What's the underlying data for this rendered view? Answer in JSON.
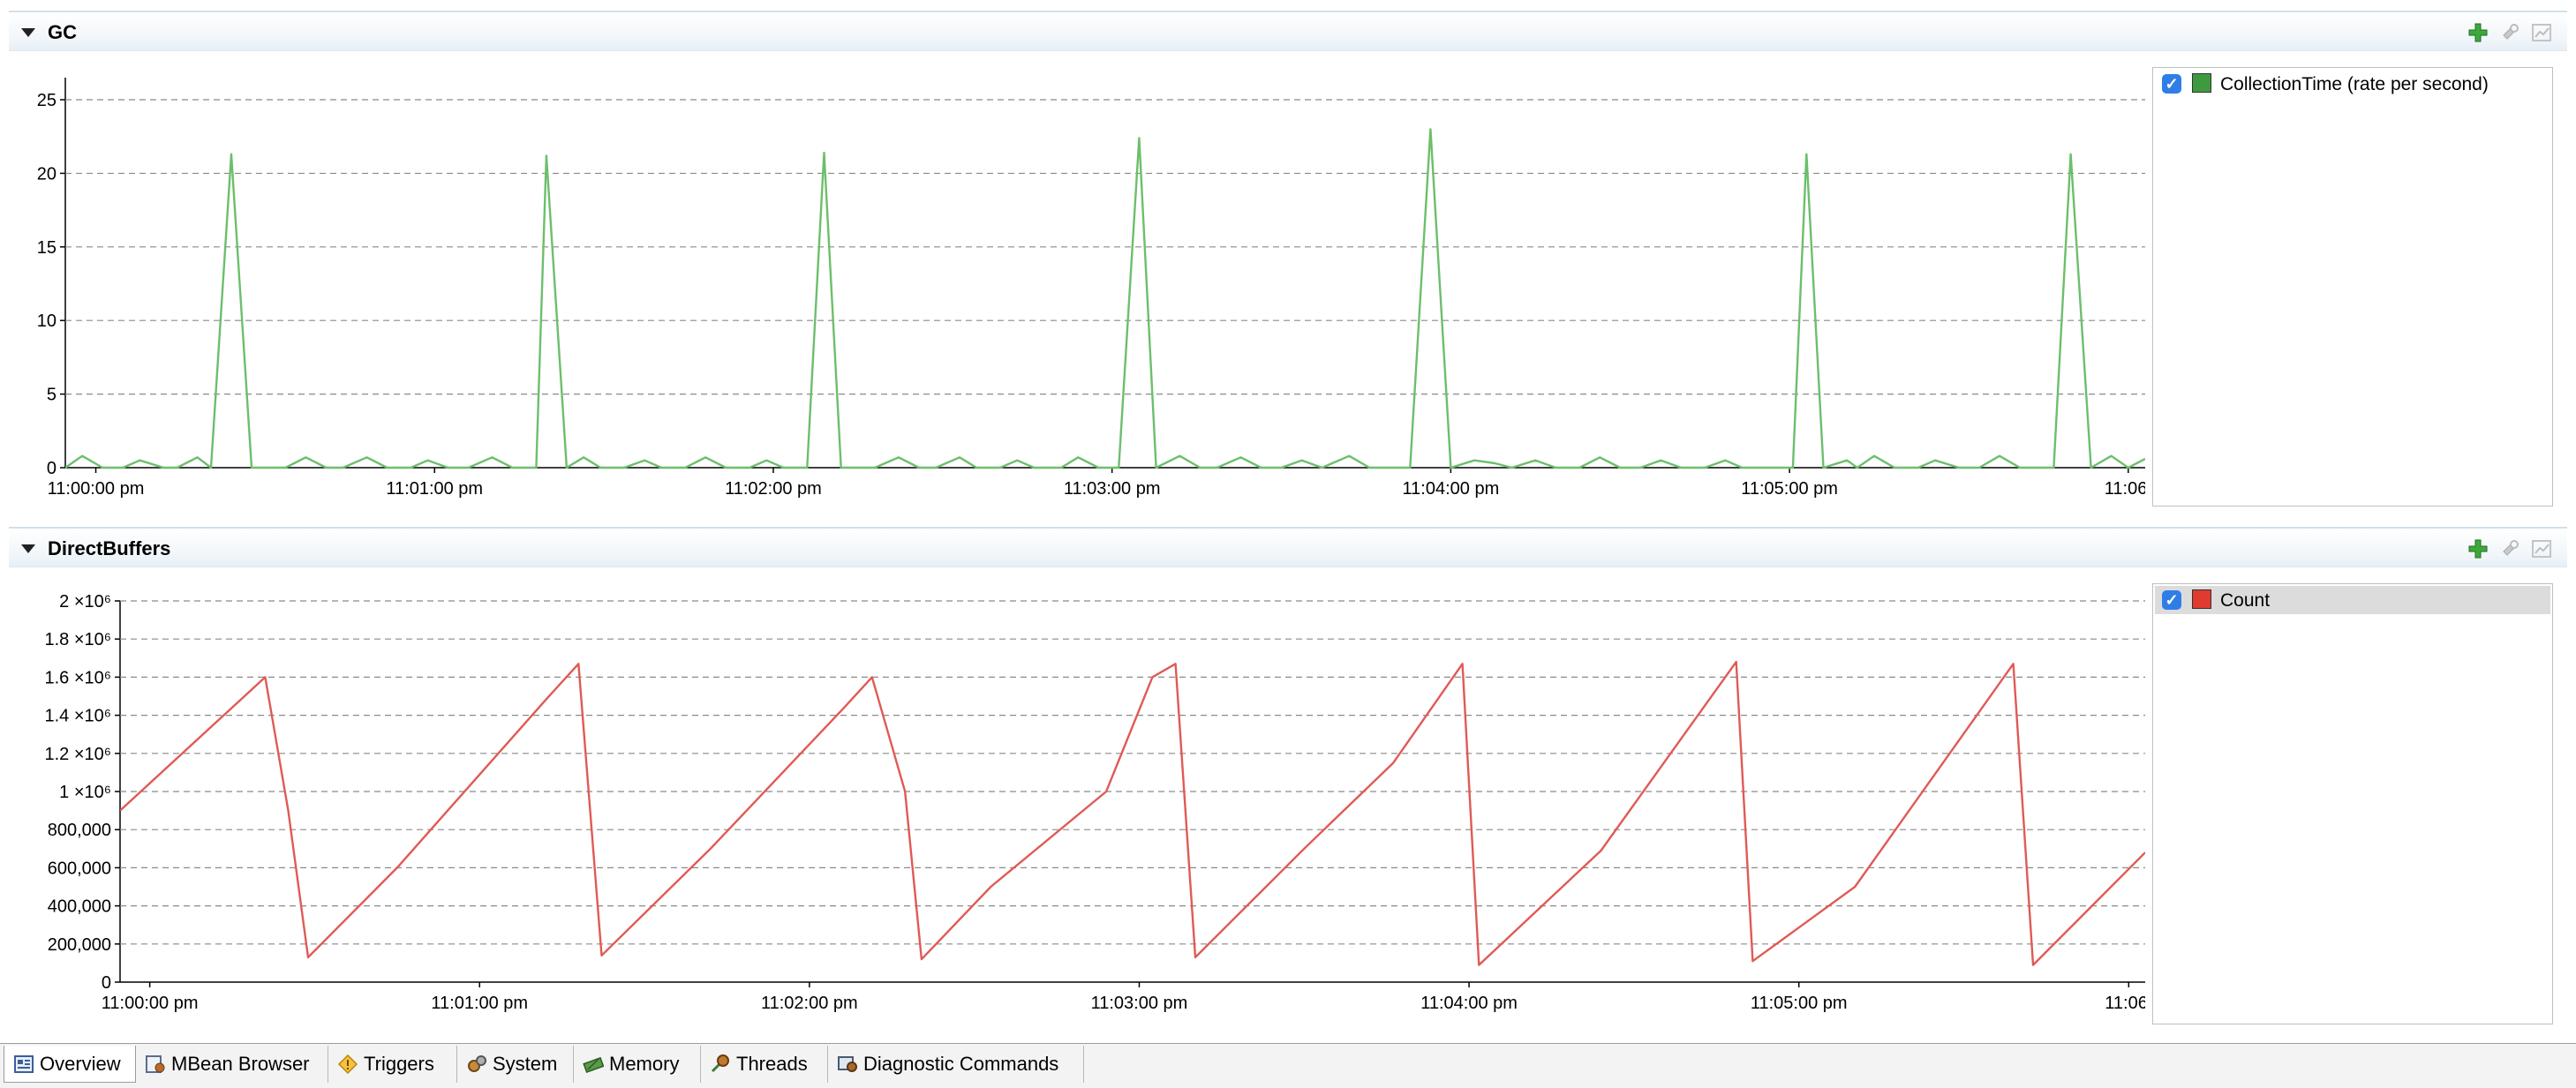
{
  "gc_panel": {
    "title": "GC",
    "legend": {
      "label": "CollectionTime (rate per second)",
      "color": "#3f9a3f",
      "checked": true
    }
  },
  "buffers_panel": {
    "title": "DirectBuffers",
    "legend": {
      "label": "Count",
      "color": "#e03b30",
      "checked": true
    }
  },
  "icons": {
    "add": "add-icon",
    "refresh": "refresh-icon",
    "settings": "chart-settings-icon"
  },
  "tabs": [
    {
      "label": "Overview",
      "icon": "overview-icon",
      "active": true
    },
    {
      "label": "MBean Browser",
      "icon": "mbean-browser-icon",
      "active": false
    },
    {
      "label": "Triggers",
      "icon": "triggers-icon",
      "active": false
    },
    {
      "label": "System",
      "icon": "system-icon",
      "active": false
    },
    {
      "label": "Memory",
      "icon": "memory-icon",
      "active": false
    },
    {
      "label": "Threads",
      "icon": "threads-icon",
      "active": false
    },
    {
      "label": "Diagnostic Commands",
      "icon": "diagnostic-commands-icon",
      "active": false
    }
  ],
  "chart_data": [
    {
      "type": "line",
      "title": "GC",
      "x_ticks": [
        "11:00:00 pm",
        "11:01:00 pm",
        "11:02:00 pm",
        "11:03:00 pm",
        "11:04:00 pm",
        "11:05:00 pm",
        "11:06:"
      ],
      "y_ticks": [
        "0",
        "5",
        "10",
        "15",
        "20",
        "25"
      ],
      "ylim": [
        0,
        26.5
      ],
      "xlim_minutes": [
        -0.09,
        6.05
      ],
      "grid": true,
      "legend_position": "right",
      "series": [
        {
          "name": "CollectionTime (rate per second)",
          "color": "#6cbf6c",
          "points": [
            [
              -0.09,
              0
            ],
            [
              -0.04,
              0.8
            ],
            [
              0.02,
              0
            ],
            [
              0.08,
              0
            ],
            [
              0.13,
              0.5
            ],
            [
              0.2,
              0
            ],
            [
              0.24,
              0
            ],
            [
              0.3,
              0.7
            ],
            [
              0.34,
              0
            ],
            [
              0.4,
              21.3
            ],
            [
              0.46,
              0
            ],
            [
              0.56,
              0
            ],
            [
              0.62,
              0.7
            ],
            [
              0.68,
              0
            ],
            [
              0.73,
              0
            ],
            [
              0.8,
              0.7
            ],
            [
              0.86,
              0
            ],
            [
              0.93,
              0
            ],
            [
              0.98,
              0.5
            ],
            [
              1.04,
              0
            ],
            [
              1.1,
              0
            ],
            [
              1.17,
              0.7
            ],
            [
              1.23,
              0
            ],
            [
              1.3,
              0
            ],
            [
              1.33,
              21.2
            ],
            [
              1.39,
              0
            ],
            [
              1.44,
              0.7
            ],
            [
              1.49,
              0
            ],
            [
              1.56,
              0
            ],
            [
              1.62,
              0.5
            ],
            [
              1.67,
              0
            ],
            [
              1.74,
              0
            ],
            [
              1.8,
              0.7
            ],
            [
              1.86,
              0
            ],
            [
              1.93,
              0
            ],
            [
              1.98,
              0.5
            ],
            [
              2.03,
              0
            ],
            [
              2.1,
              0
            ],
            [
              2.15,
              21.4
            ],
            [
              2.2,
              0
            ],
            [
              2.3,
              0
            ],
            [
              2.37,
              0.7
            ],
            [
              2.43,
              0
            ],
            [
              2.48,
              0
            ],
            [
              2.55,
              0.7
            ],
            [
              2.6,
              0
            ],
            [
              2.67,
              0
            ],
            [
              2.72,
              0.5
            ],
            [
              2.77,
              0
            ],
            [
              2.85,
              0
            ],
            [
              2.9,
              0.7
            ],
            [
              2.96,
              0
            ],
            [
              3.02,
              0
            ],
            [
              3.08,
              22.4
            ],
            [
              3.13,
              0
            ],
            [
              3.2,
              0.8
            ],
            [
              3.26,
              0
            ],
            [
              3.31,
              0
            ],
            [
              3.38,
              0.7
            ],
            [
              3.44,
              0
            ],
            [
              3.5,
              0
            ],
            [
              3.56,
              0.5
            ],
            [
              3.62,
              0
            ],
            [
              3.65,
              0.3
            ],
            [
              3.7,
              0.8
            ],
            [
              3.76,
              0
            ],
            [
              3.88,
              0
            ],
            [
              3.94,
              23
            ],
            [
              4.0,
              0
            ],
            [
              4.07,
              0.5
            ],
            [
              4.13,
              0.3
            ],
            [
              4.18,
              0
            ],
            [
              4.25,
              0.5
            ],
            [
              4.31,
              0
            ],
            [
              4.38,
              0
            ],
            [
              4.44,
              0.7
            ],
            [
              4.5,
              0
            ],
            [
              4.56,
              0
            ],
            [
              4.62,
              0.5
            ],
            [
              4.68,
              0
            ],
            [
              4.75,
              0
            ],
            [
              4.81,
              0.5
            ],
            [
              4.86,
              0
            ],
            [
              4.91,
              0
            ],
            [
              4.96,
              0
            ],
            [
              5.01,
              0
            ],
            [
              5.05,
              21.3
            ],
            [
              5.1,
              0
            ],
            [
              5.17,
              0.5
            ],
            [
              5.2,
              0
            ],
            [
              5.25,
              0.8
            ],
            [
              5.31,
              0
            ],
            [
              5.38,
              0
            ],
            [
              5.43,
              0.5
            ],
            [
              5.5,
              0
            ],
            [
              5.56,
              0
            ],
            [
              5.62,
              0.8
            ],
            [
              5.68,
              0
            ],
            [
              5.78,
              0
            ],
            [
              5.83,
              21.3
            ],
            [
              5.89,
              0
            ],
            [
              5.95,
              0.8
            ],
            [
              6.0,
              0
            ],
            [
              6.05,
              0.6
            ]
          ]
        }
      ]
    },
    {
      "type": "line",
      "title": "DirectBuffers",
      "x_ticks": [
        "11:00:00 pm",
        "11:01:00 pm",
        "11:02:00 pm",
        "11:03:00 pm",
        "11:04:00 pm",
        "11:05:00 pm",
        "11:06:"
      ],
      "y_ticks": [
        "0",
        "200,000",
        "400,000",
        "600,000",
        "800,000",
        "1 ×10⁶",
        "1.2 ×10⁶",
        "1.4 ×10⁶",
        "1.6 ×10⁶",
        "1.8 ×10⁶",
        "2 ×10⁶"
      ],
      "ylim": [
        0,
        2000000
      ],
      "xlim_minutes": [
        -0.09,
        6.05
      ],
      "grid": true,
      "legend_position": "right",
      "series": [
        {
          "name": "Count",
          "color": "#e05a55",
          "points": [
            [
              -0.09,
              900000
            ],
            [
              0.35,
              1600000
            ],
            [
              0.42,
              900000
            ],
            [
              0.48,
              130000
            ],
            [
              0.75,
              600000
            ],
            [
              1.2,
              1480000
            ],
            [
              1.3,
              1670000
            ],
            [
              1.37,
              140000
            ],
            [
              1.7,
              700000
            ],
            [
              2.1,
              1430000
            ],
            [
              2.19,
              1600000
            ],
            [
              2.29,
              1000000
            ],
            [
              2.34,
              120000
            ],
            [
              2.55,
              500000
            ],
            [
              2.9,
              1000000
            ],
            [
              3.04,
              1600000
            ],
            [
              3.11,
              1670000
            ],
            [
              3.17,
              130000
            ],
            [
              3.5,
              700000
            ],
            [
              3.77,
              1150000
            ],
            [
              3.98,
              1670000
            ],
            [
              4.03,
              90000
            ],
            [
              4.4,
              690000
            ],
            [
              4.81,
              1680000
            ],
            [
              4.86,
              110000
            ],
            [
              5.17,
              500000
            ],
            [
              5.65,
              1670000
            ],
            [
              5.71,
              90000
            ],
            [
              6.05,
              680000
            ]
          ]
        }
      ]
    }
  ]
}
